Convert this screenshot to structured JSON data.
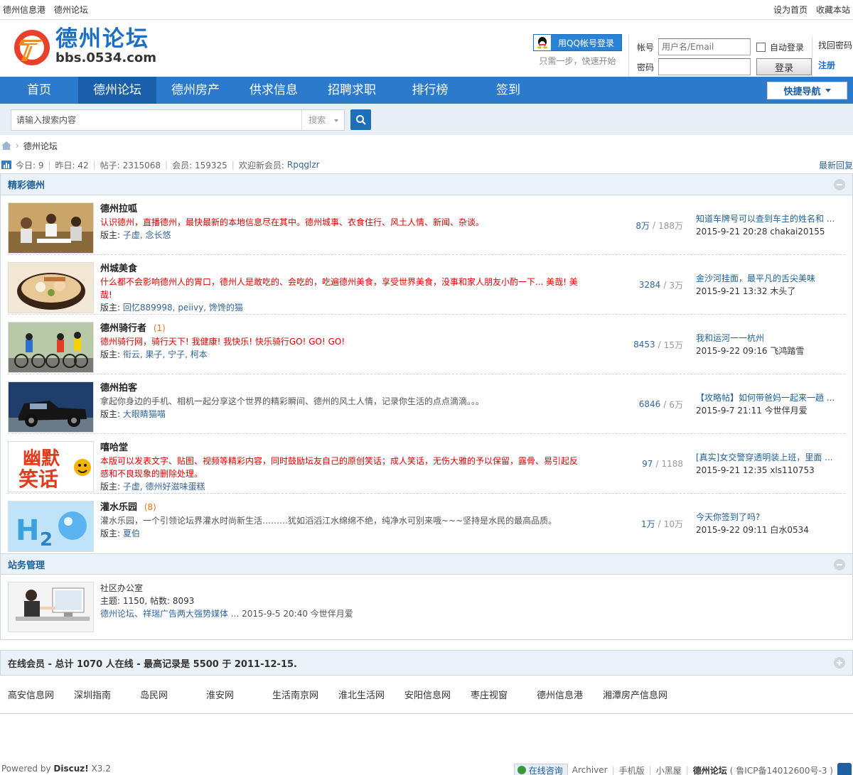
{
  "topbar": {
    "left": [
      "德州信息港",
      "德州论坛"
    ],
    "right": [
      "设为首页",
      "收藏本站"
    ]
  },
  "logo": {
    "cn": "德州论坛",
    "en": "bbs.0534.com"
  },
  "qq": {
    "button": "用QQ帐号登录",
    "note": "只需一步，快速开始"
  },
  "login": {
    "account_label": "帐号",
    "account_placeholder": "用户名/Email",
    "password_label": "密码",
    "remember": "自动登录",
    "login_button": "登录",
    "forgot": "找回密码",
    "register": "注册"
  },
  "nav": {
    "items": [
      "首页",
      "德州论坛",
      "德州房产",
      "供求信息",
      "招聘求职",
      "排行榜",
      "签到"
    ],
    "active": "德州论坛",
    "quick": "快捷导航"
  },
  "search": {
    "placeholder": "请输入搜索内容",
    "type": "搜索"
  },
  "breadcrumb": {
    "current": "德州论坛"
  },
  "stats": {
    "today": "今日: 9",
    "yesterday": "昨日: 42",
    "posts": "帖子: 2315068",
    "members": "会员: 159325",
    "welcome": "欢迎新会员:",
    "newest": "Rpqglzr",
    "latest": "最新回复"
  },
  "category1": {
    "title": "精彩德州",
    "forums": [
      {
        "name": "德州拉呱",
        "new": "",
        "desc": "认识德州，直播德州，最快最新的本地信息尽在其中。德州城事、衣食住行、风土人情、新闻、杂谈。",
        "desc_color": "red",
        "mods_label": "版主:",
        "mods": "子虚, 念长悠",
        "threads": "8万",
        "posts": "188万",
        "last_title": "知道车牌号可以查到车主的姓名和 ...",
        "last_meta": "2015-9-21 20:28 chakai20155"
      },
      {
        "name": "州城美食",
        "new": "",
        "desc": "什么都不会影响德州人的胃口，德州人是敢吃的、会吃的，吃遍德州美食，享受世界美食，没事和家人朋友小酌一下... 美哉! 美哉!",
        "desc_color": "red",
        "mods_label": "版主:",
        "mods": "回忆889998, peiivy, 馋馋的猫",
        "threads": "3284",
        "posts": "3万",
        "last_title": "金沙河挂面，最平凡的舌尖美味",
        "last_meta": "2015-9-21 13:32 木头了"
      },
      {
        "name": "德州骑行者",
        "new": "(1)",
        "desc": "德州骑行网，骑行天下! 我健康! 我快乐! 快乐骑行GO! GO! GO!",
        "desc_color": "red",
        "mods_label": "版主:",
        "mods": "衔云, 果子, 宁子, 柯本",
        "threads": "8453",
        "posts": "15万",
        "last_title": "我和运河一一杭州",
        "last_meta": "2015-9-22 09:16 飞鸿踏雪"
      },
      {
        "name": "德州拍客",
        "new": "",
        "desc": "拿起你身边的手机、相机一起分享这个世界的精彩瞬间、德州的风土人情，记录你生活的点点滴滴。。。",
        "desc_color": "gray",
        "mods_label": "版主:",
        "mods": "大眼睛猫喵",
        "threads": "6846",
        "posts": "6万",
        "last_title": "【攻略帖】如何带爸妈一起来一趟 ...",
        "last_meta": "2015-9-7 21:11 今世伴月爱"
      },
      {
        "name": "嘻哈堂",
        "new": "",
        "desc": "本版可以发表文字、贴图、视频等精彩内容，同时鼓励坛友自己的原创笑话；成人笑话，无伤大雅的予以保留，露骨、易引起反感和不良现象的删除处理。",
        "desc_color": "red",
        "mods_label": "版主:",
        "mods": "子虚, 德州好滋味蛋糕",
        "threads": "97",
        "posts": "1188",
        "last_title": "[真实]女交警穿透明装上班，里面 ...",
        "last_meta": "2015-9-21 12:35 xls110753"
      },
      {
        "name": "灌水乐园",
        "new": "(8)",
        "desc": "灌水乐园，一个引领论坛界灌水时尚新生活………犹如滔滔江水绵绵不绝，纯净水可别来哦~~~坚持是水民的最高品质。",
        "desc_color": "gray",
        "mods_label": "版主:",
        "mods": "夏伯",
        "threads": "1万",
        "posts": "10万",
        "last_title": "今天你签到了吗?",
        "last_meta": "2015-9-22 09:11 白水0534"
      }
    ]
  },
  "category2": {
    "title": "站务管理",
    "forum": {
      "name": "社区办公室",
      "stats": "主题: 1150, 帖数: 8093",
      "last_link": "德州论坛、祥瑞广告两大强势媒体 ...",
      "last_meta": "2015-9-5 20:40 今世伴月爱"
    }
  },
  "online": {
    "text": "在线会员  - 总计  1070  人在线  - 最高记录是  5500  于  2011-12-15."
  },
  "links": [
    "高安信息网",
    "深圳指南",
    "岛民网",
    "淮安网",
    "生活南京网",
    "淮北生活网",
    "安阳信息网",
    "枣庄视窗",
    "德州信息港",
    "湘潭房产信息网"
  ],
  "footer": {
    "powered": "Powered by",
    "discuz": "Discuz!",
    "version": "X3.2",
    "chat": "在线咨询",
    "archiver": "Archiver",
    "mobile": "手机版",
    "blackroom": "小黑屋",
    "site": "德州论坛",
    "icp": "( 鲁ICP备14012600号-3 )"
  },
  "colors": {
    "nav": "#2b7acb",
    "nav_active": "#1a5fa9",
    "link": "#336699",
    "red_desc": "#e00000"
  }
}
